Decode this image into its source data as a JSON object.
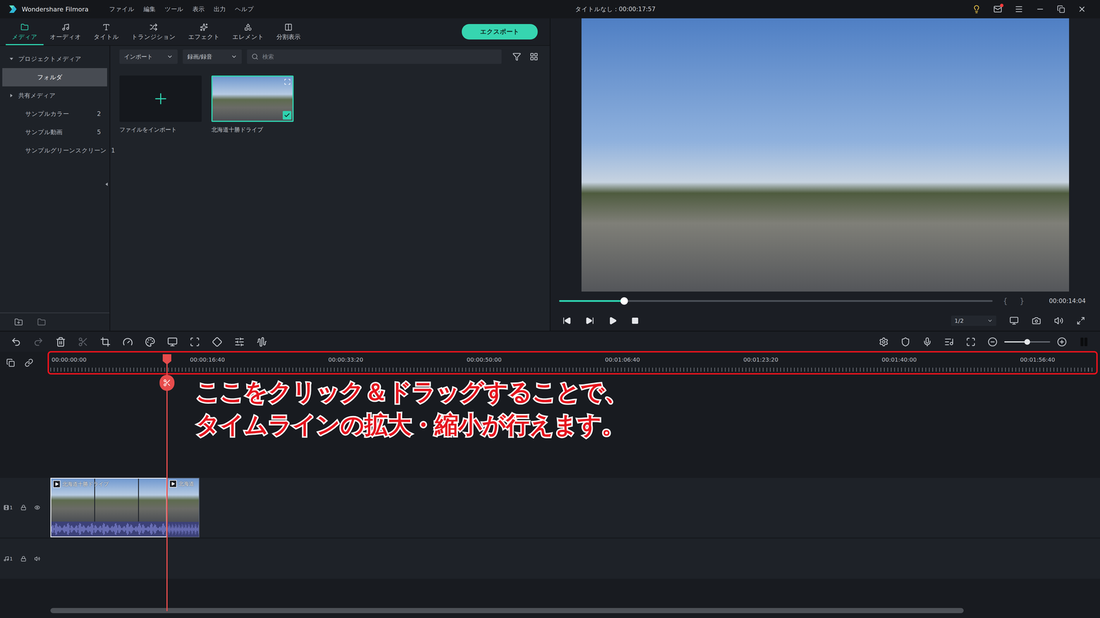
{
  "app": {
    "name": "Wondershare Filmora"
  },
  "menu": [
    "ファイル",
    "編集",
    "ツール",
    "表示",
    "出力",
    "ヘルプ"
  ],
  "window": {
    "title": "タイトルなし : 00:00:17:57"
  },
  "notifications": {
    "mail_badge": true
  },
  "tabs": [
    {
      "label": "メディア",
      "selected": true
    },
    {
      "label": "オーディオ",
      "selected": false
    },
    {
      "label": "タイトル",
      "selected": false
    },
    {
      "label": "トランジション",
      "selected": false
    },
    {
      "label": "エフェクト",
      "selected": false
    },
    {
      "label": "エレメント",
      "selected": false
    },
    {
      "label": "分割表示",
      "selected": false
    }
  ],
  "export_button": "エクスポート",
  "sidebar": {
    "items": [
      {
        "label": "プロジェクトメディア",
        "count": "",
        "kind": "group",
        "expanded": true,
        "selected": false
      },
      {
        "label": "フォルダ",
        "count": "",
        "kind": "child",
        "expanded": false,
        "selected": true
      },
      {
        "label": "共有メディア",
        "count": "",
        "kind": "group",
        "expanded": false,
        "selected": false
      },
      {
        "label": "サンプルカラー",
        "count": "2",
        "kind": "item",
        "expanded": false,
        "selected": false
      },
      {
        "label": "サンプル動画",
        "count": "5",
        "kind": "item",
        "expanded": false,
        "selected": false
      },
      {
        "label": "サンプルグリーンスクリーン",
        "count": "1",
        "kind": "item",
        "expanded": false,
        "selected": false
      }
    ]
  },
  "media_toolbar": {
    "import": "インポート",
    "record": "録画/録音",
    "search_placeholder": "検索"
  },
  "media_items": [
    {
      "kind": "import",
      "label": "ファイルをインポート",
      "selected": false
    },
    {
      "kind": "clip",
      "label": "北海道十勝ドライブ",
      "selected": true
    }
  ],
  "preview": {
    "progress": {
      "level": 0.15
    },
    "marks": [
      "{",
      "}"
    ],
    "time": "00:00:14:04",
    "quality": "1/2"
  },
  "timeline": {
    "zoom": {
      "level": 0.5
    },
    "ruler": [
      "00:00:00:00",
      "00:00:16:40",
      "00:00:33:20",
      "00:00:50:00",
      "00:01:06:40",
      "00:01:23:20",
      "00:01:40:00",
      "00:01:56:40"
    ],
    "playhead": {
      "level": 0.111
    },
    "tracks": [
      {
        "kind": "video",
        "number": "1",
        "locked": false,
        "visible": true
      },
      {
        "kind": "audio",
        "number": "1",
        "locked": false,
        "visible": true
      }
    ],
    "clips": [
      {
        "track": "video",
        "label": "北海道十勝ドライブ",
        "start": 0,
        "end": 0.111,
        "selected": true
      },
      {
        "track": "video",
        "label": "北海道",
        "start": 0.111,
        "end": 0.142,
        "selected": false
      }
    ],
    "scrollbar": {
      "level": 0.87
    }
  },
  "annotation": {
    "lines": [
      "ここをクリック＆ドラッグすることで、",
      "タイムラインの拡大・縮小が行えます。"
    ]
  }
}
